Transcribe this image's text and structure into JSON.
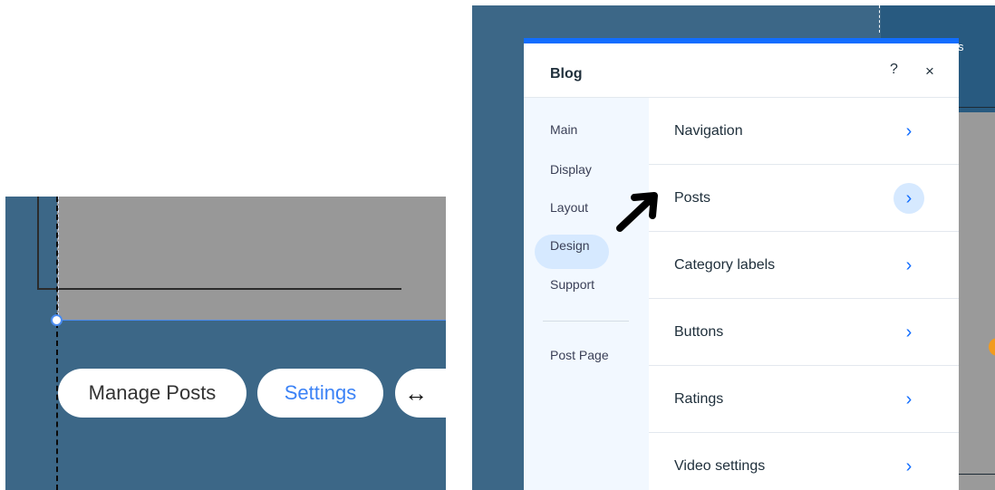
{
  "left": {
    "manage_posts": "Manage Posts",
    "settings": "Settings",
    "stretch_icon": "↔"
  },
  "right_backdrop": {
    "topbar_text": "s"
  },
  "dialog": {
    "title": "Blog",
    "help": "?",
    "close": "×",
    "sidebar": {
      "items": [
        "Main",
        "Display",
        "Layout",
        "Design",
        "Support"
      ],
      "active": "Design",
      "extra": "Post Page"
    },
    "rows": [
      {
        "label": "Navigation"
      },
      {
        "label": "Posts",
        "hovered": true
      },
      {
        "label": "Category labels"
      },
      {
        "label": "Buttons"
      },
      {
        "label": "Ratings"
      },
      {
        "label": "Video settings"
      }
    ],
    "chevron": "›"
  },
  "colors": {
    "accent": "#116dff",
    "canvas": "#3c6787",
    "sidebar_bg": "#f2f8ff",
    "active_bg": "#d6e9ff"
  },
  "annotation": {
    "arrow_icon": "hand-drawn-arrow-icon"
  }
}
